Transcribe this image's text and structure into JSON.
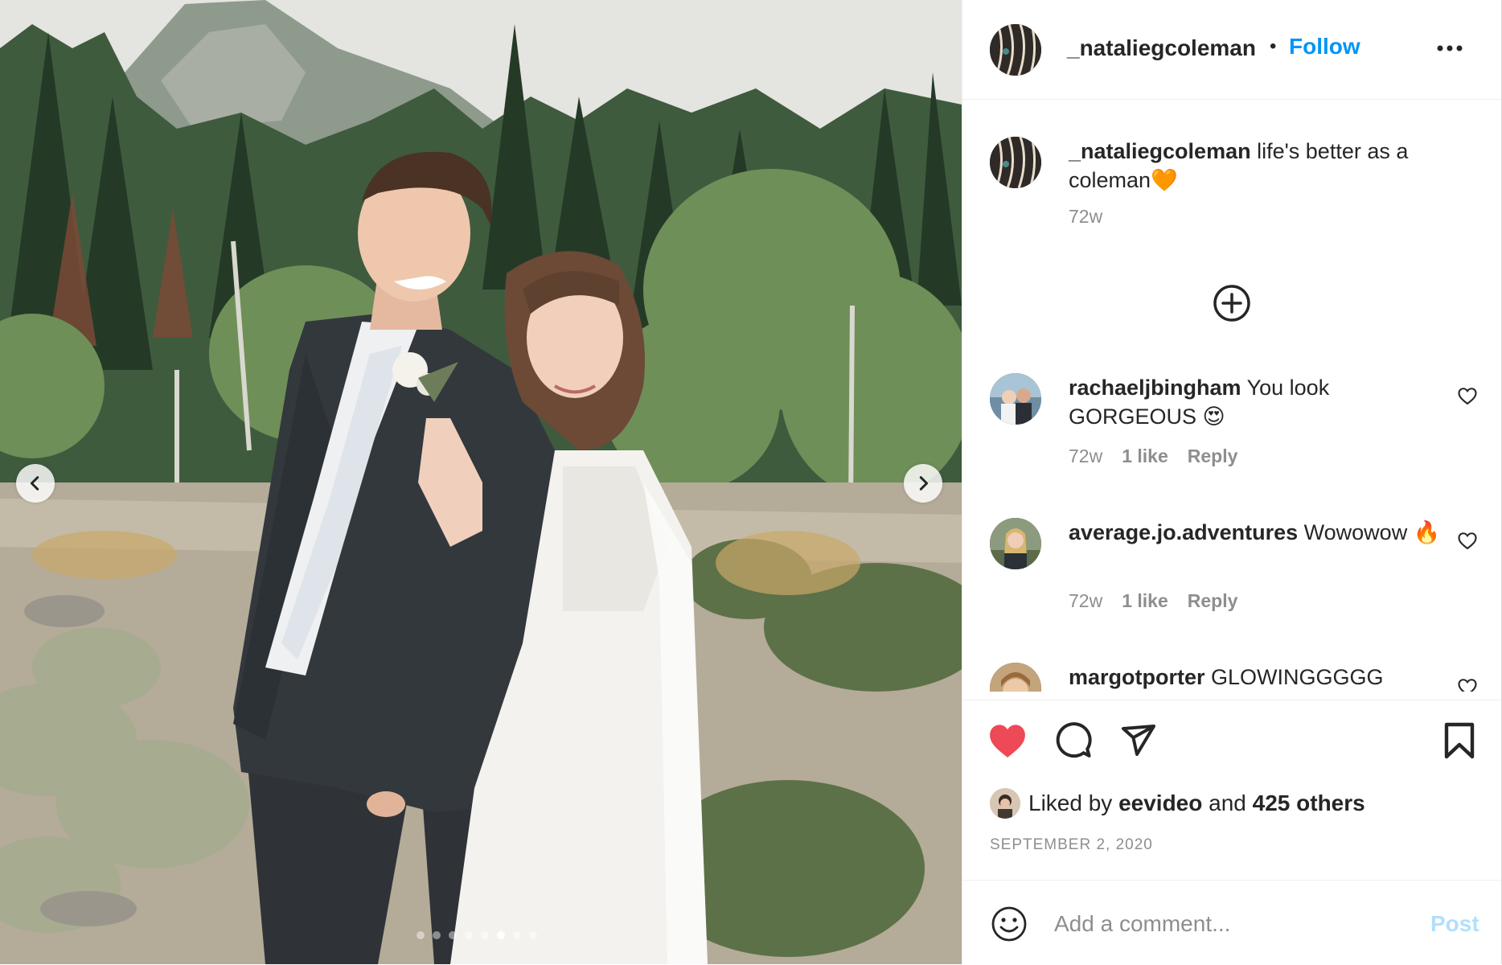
{
  "post": {
    "author": {
      "username": "_nataliegcoleman",
      "separator": "•",
      "follow_label": "Follow"
    },
    "caption": {
      "username": "_nataliegcoleman",
      "text": "life's better as a coleman",
      "emoji": "🧡",
      "age": "72w"
    },
    "media": {
      "slide_count": 8,
      "active_slide": 6,
      "prev_icon": "chevron-left-icon",
      "next_icon": "chevron-right-icon"
    },
    "comments": [
      {
        "username": "rachaeljbingham",
        "text": "You look GORGEOUS",
        "emoji": "😍",
        "age": "72w",
        "likes": "1 like",
        "reply": "Reply"
      },
      {
        "username": "average.jo.adventures",
        "text": "Wowowow",
        "emoji": "🔥",
        "age": "72w",
        "likes": "1 like",
        "reply": "Reply"
      },
      {
        "username": "margotporter",
        "text": "GLOWINGGGGG",
        "emoji": "",
        "age": "",
        "likes": "",
        "reply": ""
      }
    ],
    "actions": {
      "liked": true,
      "like_color": "#ed4956",
      "like_icon": "heart-filled-icon",
      "comment_icon": "comment-icon",
      "share_icon": "send-icon",
      "save_icon": "bookmark-icon"
    },
    "likes": {
      "prefix": "Liked by",
      "user": "eevideo",
      "and": "and",
      "others": "425 others"
    },
    "date": "SEPTEMBER 2, 2020",
    "compose": {
      "placeholder": "Add a comment...",
      "post_label": "Post",
      "emoji_icon": "smiley-icon"
    },
    "colors": {
      "link": "#0095f6",
      "post_disabled": "#b2dffc",
      "secondary_text": "#8e8e8e"
    }
  }
}
